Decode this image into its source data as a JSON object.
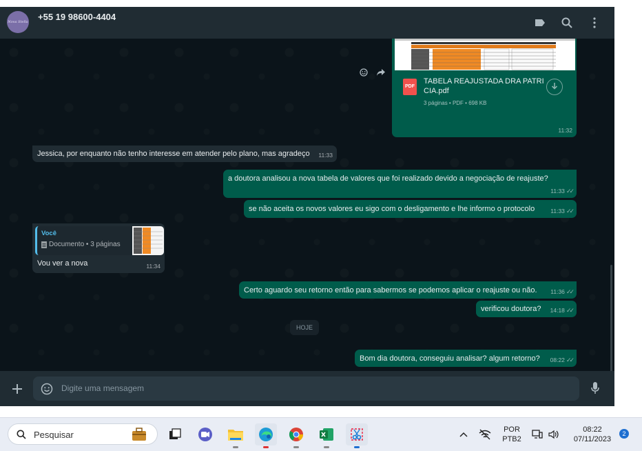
{
  "header": {
    "avatar_text": "Nova Stella",
    "contact_name": "+55 19 98600-4404",
    "label_icon": "label-icon",
    "search_icon": "search-icon",
    "menu_icon": "more-vertical-icon"
  },
  "messages": {
    "document": {
      "title": "TABELA REAJUSTADA DRA PATRI CIA.pdf",
      "meta": "3 páginas • PDF • 698 KB",
      "icon_label": "PDF",
      "time": "11:32"
    },
    "m1": {
      "text": "Jessica, por enquanto não tenho interesse em atender pelo plano, mas agradeço",
      "time": "11:33"
    },
    "m2": {
      "text": "a doutora analisou a nova tabela de valores que foi realizado devido a negociação de reajuste?",
      "time": "11:33"
    },
    "m3": {
      "text": "se não aceita os novos valores eu sigo com o desligamento e lhe informo o protocolo",
      "time": "11:33"
    },
    "m4": {
      "quote_author": "Você",
      "quote_text": "Documento • 3 páginas",
      "text": "Vou ver a nova",
      "time": "11:34"
    },
    "m5": {
      "text": "Certo aguardo seu retorno então para sabermos se podemos aplicar o reajuste ou não.",
      "time": "11:36"
    },
    "m6": {
      "text": "verificou doutora?",
      "time": "14:18"
    },
    "date_chip": "HOJE",
    "m7": {
      "text": "Bom dia doutora, conseguiu analisar? algum retorno?",
      "time": "08:22"
    }
  },
  "compose": {
    "placeholder": "Digite uma mensagem"
  },
  "taskbar": {
    "search_label": "Pesquisar",
    "lang_top": "POR",
    "lang_bottom": "PTB2",
    "time": "08:22",
    "date": "07/11/2023",
    "notification_count": "2",
    "colors": {
      "accent": "#005c4b",
      "brand_green": "#00a884"
    }
  }
}
